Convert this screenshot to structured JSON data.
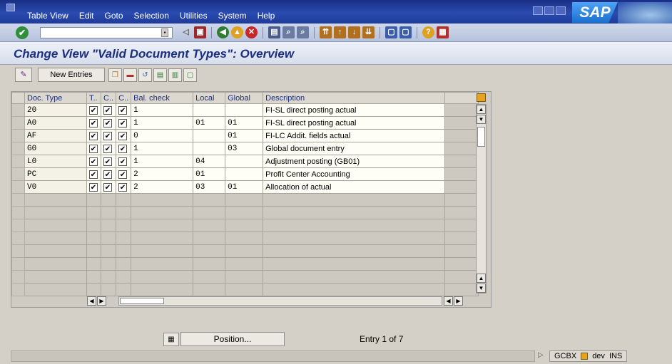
{
  "menubar": {
    "items": [
      "Table View",
      "Edit",
      "Goto",
      "Selection",
      "Utilities",
      "System",
      "Help"
    ],
    "logo": "SAP"
  },
  "toolbar": {
    "command_field_value": ""
  },
  "title": "Change View \"Valid Document Types\": Overview",
  "app_toolbar": {
    "new_entries_label": "New Entries"
  },
  "table": {
    "headers": [
      "Doc. Type",
      "T..",
      "C..",
      "C..",
      "Bal. check",
      "Local",
      "Global",
      "Description"
    ],
    "rows": [
      {
        "doc_type": "20",
        "c1": true,
        "c2": true,
        "c3": true,
        "bal_check": "1",
        "local": "",
        "global": "",
        "description": "FI-SL direct posting actual"
      },
      {
        "doc_type": "A0",
        "c1": true,
        "c2": true,
        "c3": true,
        "bal_check": "1",
        "local": "01",
        "global": "01",
        "description": "FI-SL direct posting actual"
      },
      {
        "doc_type": "AF",
        "c1": true,
        "c2": true,
        "c3": true,
        "bal_check": "0",
        "local": "",
        "global": "01",
        "description": "FI-LC Addit. fields actual"
      },
      {
        "doc_type": "G0",
        "c1": true,
        "c2": true,
        "c3": true,
        "bal_check": "1",
        "local": "",
        "global": "03",
        "description": "Global document entry"
      },
      {
        "doc_type": "L0",
        "c1": true,
        "c2": true,
        "c3": true,
        "bal_check": "1",
        "local": "04",
        "global": "",
        "description": "Adjustment posting (GB01)"
      },
      {
        "doc_type": "PC",
        "c1": true,
        "c2": true,
        "c3": true,
        "bal_check": "2",
        "local": "01",
        "global": "",
        "description": "Profit Center Accounting"
      },
      {
        "doc_type": "V0",
        "c1": true,
        "c2": true,
        "c3": true,
        "bal_check": "2",
        "local": "03",
        "global": "01",
        "description": "Allocation of actual"
      }
    ]
  },
  "bottom": {
    "position_label": "Position...",
    "entry_text": "Entry 1 of 7"
  },
  "status": {
    "system": "GCBX",
    "client": "dev",
    "mode": "INS"
  },
  "colors": {
    "menubar": "#1f3a9a",
    "title": "#1b2f80",
    "accent": "#e8a31d"
  }
}
